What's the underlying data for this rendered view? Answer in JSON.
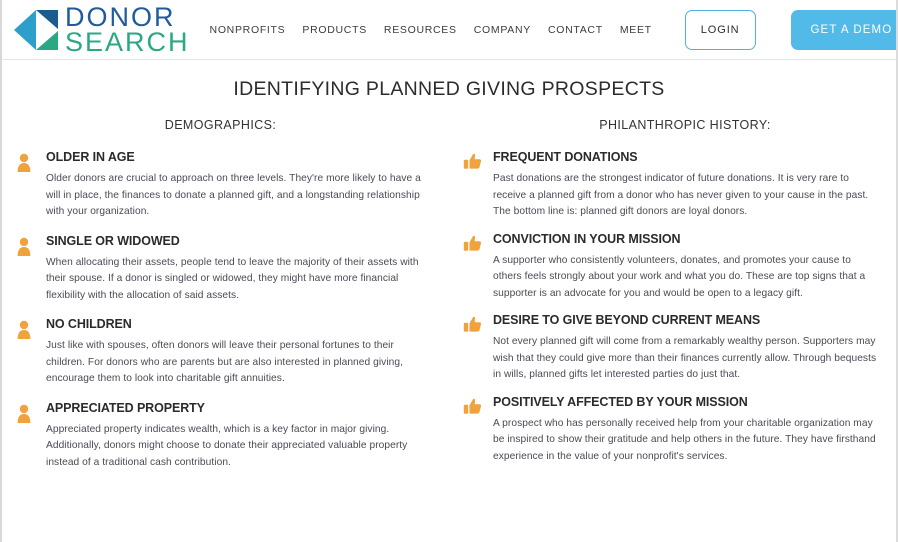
{
  "header": {
    "logo": {
      "line1": "DONOR",
      "line2": "SEARCH",
      "mark_icon": "donorsearch-triangles-logo",
      "colors": {
        "dark_blue": "#1f5b9e",
        "green": "#2aa884",
        "light_blue": "#2e9ecb"
      }
    },
    "nav_items": [
      {
        "label": "NONPROFITS"
      },
      {
        "label": "PRODUCTS"
      },
      {
        "label": "RESOURCES"
      },
      {
        "label": "COMPANY"
      },
      {
        "label": "CONTACT"
      },
      {
        "label": "MEET"
      }
    ],
    "login_label": "LOGIN",
    "demo_label": "GET A DEMO",
    "accent_color": "#52bae8"
  },
  "main": {
    "title": "IDENTIFYING PLANNED GIVING PROSPECTS",
    "left_column": {
      "heading": "DEMOGRAPHICS:",
      "icon": "person-icon",
      "icon_color": "#f0a23c",
      "items": [
        {
          "title": "OLDER IN AGE",
          "desc": "Older donors are crucial to approach on three levels. They're more likely to have a will in place, the finances to donate a planned gift, and a longstanding relationship with your organization."
        },
        {
          "title": "SINGLE OR WIDOWED",
          "desc": "When allocating their assets, people tend to leave the majority of their assets with their spouse. If a donor is singled or widowed, they might have more financial flexibility with the allocation of said assets."
        },
        {
          "title": "NO CHILDREN",
          "desc": "Just like with spouses, often donors will leave their personal fortunes to their children. For donors who are parents but are also interested in planned giving, encourage them to look into charitable gift annuities."
        },
        {
          "title": "APPRECIATED PROPERTY",
          "desc": "Appreciated property indicates wealth, which is a key factor in major giving. Additionally, donors might choose to donate their appreciated valuable property instead of a traditional cash contribution."
        }
      ]
    },
    "right_column": {
      "heading": "PHILANTHROPIC HISTORY:",
      "icon": "thumbs-up-icon",
      "icon_color": "#f0a23c",
      "items": [
        {
          "title": "FREQUENT DONATIONS",
          "desc": "Past donations are the strongest indicator of future donations. It is very rare to receive a planned gift from a donor who has never given to your cause in the past. The bottom line is: planned gift donors are loyal donors."
        },
        {
          "title": "CONVICTION IN YOUR MISSION",
          "desc": "A supporter who consistently volunteers, donates, and promotes your cause to others feels strongly about your work and what you do. These are top signs that a supporter is an advocate for you and would be open to a legacy gift."
        },
        {
          "title": "DESIRE TO GIVE BEYOND CURRENT MEANS",
          "desc": "Not every planned gift will come from a remarkably wealthy person. Supporters may wish that they could give more than their finances currently allow. Through bequests in wills, planned gifts let interested parties do just that."
        },
        {
          "title": "POSITIVELY AFFECTED BY YOUR MISSION",
          "desc": "A prospect who has personally received help from your charitable organization may be inspired to show their gratitude and help others in the future. They have firsthand experience in the value of your nonprofit's services."
        }
      ]
    }
  }
}
